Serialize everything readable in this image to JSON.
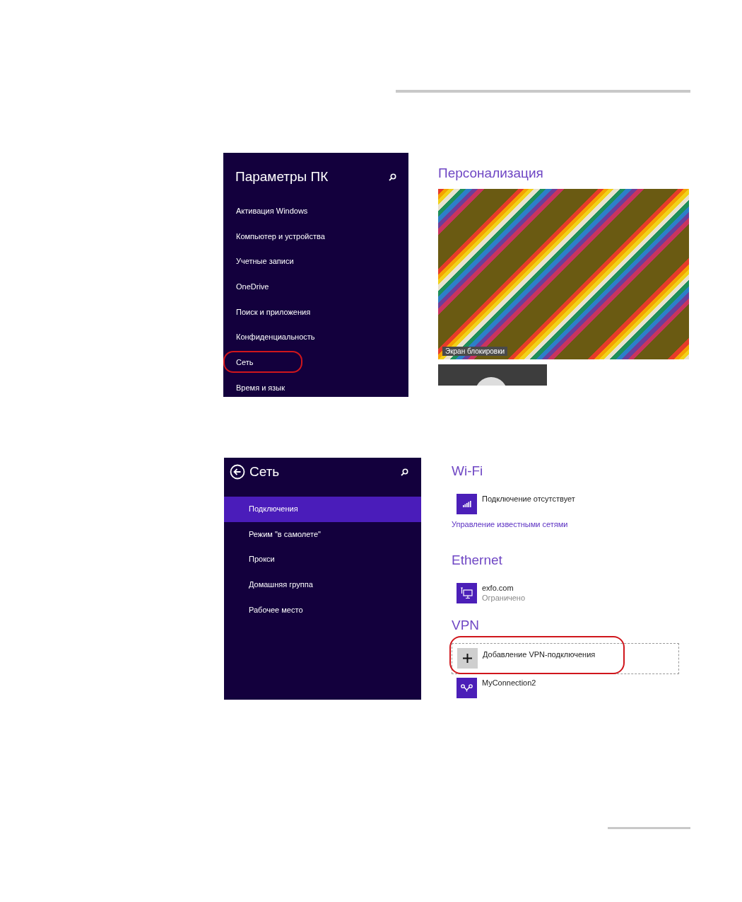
{
  "pc_settings": {
    "title": "Параметры ПК",
    "nav_items": [
      {
        "label": "Активация Windows",
        "highlighted": false
      },
      {
        "label": "Компьютер и устройства",
        "highlighted": false
      },
      {
        "label": "Учетные записи",
        "highlighted": false
      },
      {
        "label": "OneDrive",
        "highlighted": false
      },
      {
        "label": "Поиск и приложения",
        "highlighted": false
      },
      {
        "label": "Конфиденциальность",
        "highlighted": false
      },
      {
        "label": "Сеть",
        "highlighted": true
      },
      {
        "label": "Время и язык",
        "highlighted": false
      }
    ],
    "personalization": {
      "heading": "Персонализация",
      "lock_screen_caption": "Экран блокировки"
    }
  },
  "network_settings": {
    "title": "Сеть",
    "nav_items": [
      {
        "label": "Подключения",
        "selected": true
      },
      {
        "label": "Режим \"в самолете\"",
        "selected": false
      },
      {
        "label": "Прокси",
        "selected": false
      },
      {
        "label": "Домашняя группа",
        "selected": false
      },
      {
        "label": "Рабочее место",
        "selected": false
      }
    ],
    "wifi": {
      "heading": "Wi-Fi",
      "status": "Подключение отсутствует",
      "link": "Управление известными сетями"
    },
    "ethernet": {
      "heading": "Ethernet",
      "name": "exfo.com",
      "status": "Ограничено"
    },
    "vpn": {
      "heading": "VPN",
      "connections": [
        {
          "kind": "add",
          "label": "Добавление VPN-подключения",
          "highlighted": true
        },
        {
          "kind": "connection",
          "label": "MyConnection2",
          "highlighted": false
        }
      ]
    }
  }
}
